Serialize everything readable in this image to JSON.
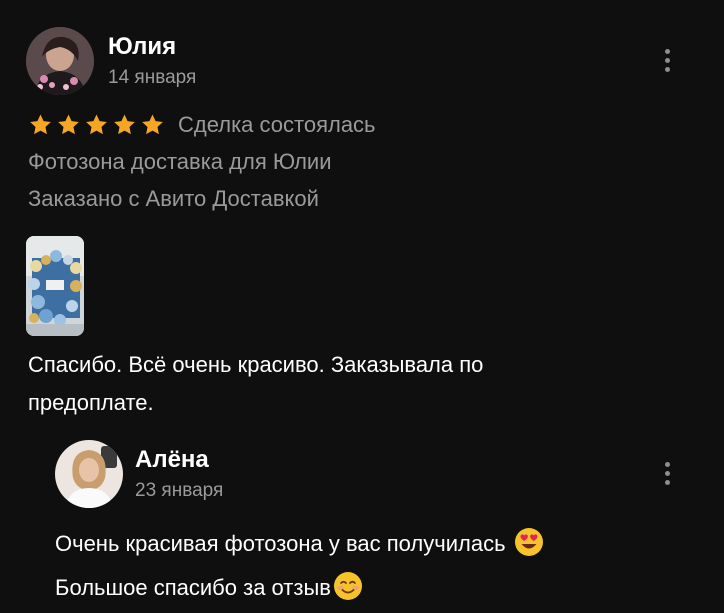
{
  "review": {
    "author": "Юлия",
    "date": "14 января",
    "rating": 5,
    "status": "Сделка состоялась",
    "item": "Фотозона доставка для Юлии",
    "delivery": "Заказано с Авито Доставкой",
    "text": "Спасибо. Всё очень красиво. Заказывала по предоплате.",
    "star_color": "#f5a623"
  },
  "reply": {
    "author": "Алёна",
    "date": "23 января",
    "line1": "Очень красивая фотозона у вас получилась",
    "line2": "Большое спасибо за отзыв",
    "emoji1": "heart-eyes-emoji",
    "emoji2": "smiling-emoji"
  }
}
